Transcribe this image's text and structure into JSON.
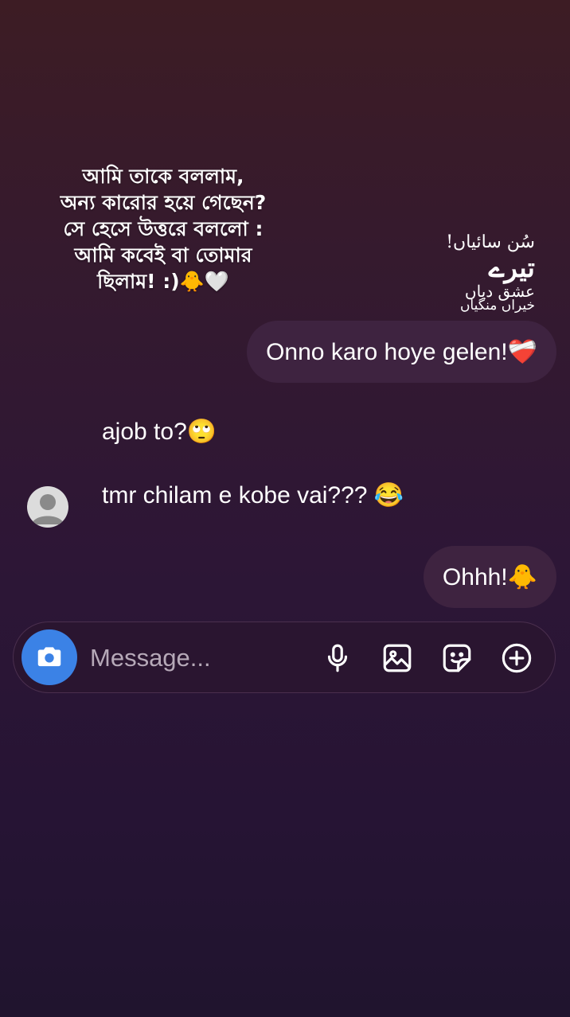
{
  "overlay": {
    "bengali_text": "আমি তাকে বললাম,\nঅন্য কারোর হয়ে গেছেন?\nসে হেসে উত্তরে বললো :\nআমি কবেই বা তোমার\nছিলাম! :)🐥🤍",
    "urdu_line1": "سُن سائیاں!",
    "urdu_line2": "تیرے",
    "urdu_line3": "عشق دیاں",
    "urdu_line4": "خیراں منگیاں"
  },
  "messages": {
    "sent_1": "Onno karo hoye gelen!❤️‍🩹",
    "received_1": "ajob to?🙄",
    "received_2": "tmr chilam e kobe vai??? 😂",
    "sent_2": "Ohhh!🐥"
  },
  "composer": {
    "placeholder": "Message..."
  },
  "icons": {
    "camera": "camera-icon",
    "mic": "microphone-icon",
    "gallery": "image-icon",
    "sticker": "sticker-icon",
    "add": "plus-circle-icon",
    "avatar": "avatar-placeholder"
  },
  "colors": {
    "camera_button": "#3b82e6",
    "bubble": "#3e2340"
  }
}
